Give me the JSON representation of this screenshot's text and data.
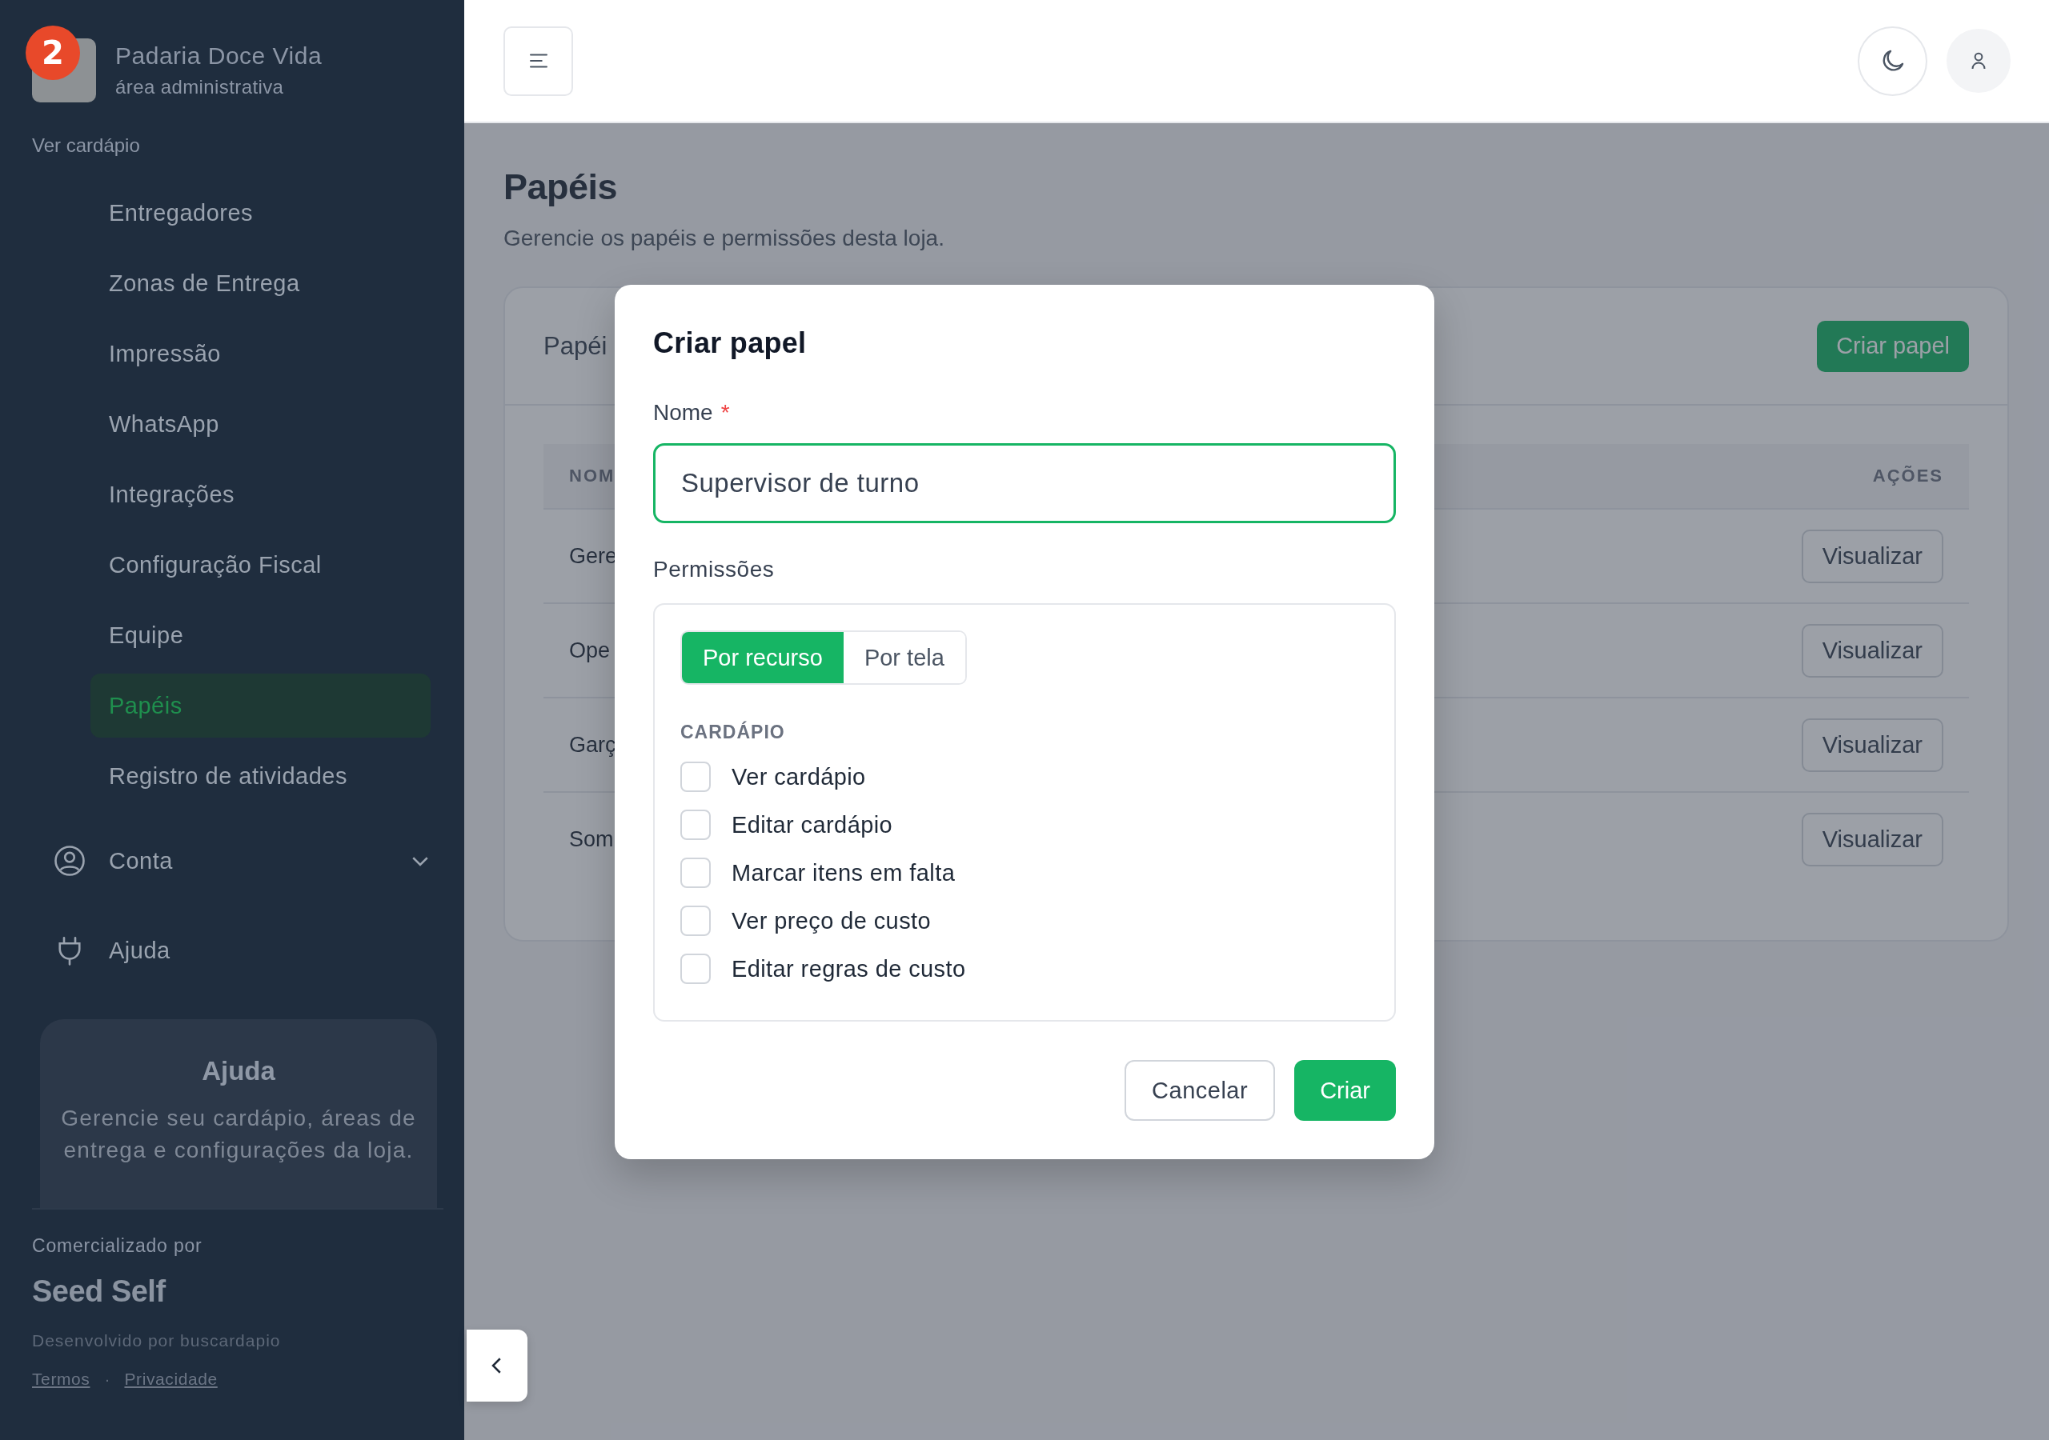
{
  "sidebar": {
    "notification_count": "2",
    "store_name": "Padaria Doce Vida",
    "store_subtitle": "área administrativa",
    "menu_link": "Ver cardápio",
    "items": [
      {
        "label": "Entregadores",
        "selected": false
      },
      {
        "label": "Zonas de Entrega",
        "selected": false
      },
      {
        "label": "Impressão",
        "selected": false
      },
      {
        "label": "WhatsApp",
        "selected": false
      },
      {
        "label": "Integrações",
        "selected": false
      },
      {
        "label": "Configuração Fiscal",
        "selected": false
      },
      {
        "label": "Equipe",
        "selected": false
      },
      {
        "label": "Papéis",
        "selected": true
      },
      {
        "label": "Registro de atividades",
        "selected": false
      }
    ],
    "sections": [
      {
        "kind": "account",
        "label": "Conta",
        "expanded": false
      },
      {
        "kind": "help",
        "label": "Ajuda"
      }
    ],
    "help_card": {
      "title": "Ajuda",
      "text": "Gerencie seu cardápio, áreas de entrega e configurações da loja."
    },
    "footer": {
      "label": "Comercializado por",
      "brand": "Seed Self",
      "developer": "Desenvolvido por buscardapio",
      "links": [
        "Termos",
        "Privacidade"
      ],
      "separator": "·"
    }
  },
  "page": {
    "title": "Papéis",
    "subtitle": "Gerencie os papéis e permissões desta loja."
  },
  "card": {
    "title": "Papéi",
    "button": "Criar papel",
    "columns": [
      "NOM",
      "AÇÕES"
    ],
    "rows": [
      {
        "name": "Gere",
        "action": "Visualizar"
      },
      {
        "name": "Ope",
        "action": "Visualizar"
      },
      {
        "name": "Garç",
        "action": "Visualizar"
      },
      {
        "name": "Som",
        "action": "Visualizar"
      }
    ]
  },
  "dialog": {
    "title": "Criar papel",
    "name_label": "Nome",
    "required_mark": "*",
    "name_value": "Supervisor de turno",
    "permissions_label": "Permissões",
    "tabs": [
      {
        "label": "Por recurso",
        "selected": true
      },
      {
        "label": "Por tela",
        "selected": false
      }
    ],
    "group": "CARDÁPIO",
    "permissions": [
      {
        "label": "Ver cardápio",
        "checked": false
      },
      {
        "label": "Editar cardápio",
        "checked": false
      },
      {
        "label": "Marcar itens em falta",
        "checked": false
      },
      {
        "label": "Ver preço de custo",
        "checked": false
      },
      {
        "label": "Editar regras de custo",
        "checked": false
      }
    ],
    "cancel": "Cancelar",
    "submit": "Criar"
  }
}
